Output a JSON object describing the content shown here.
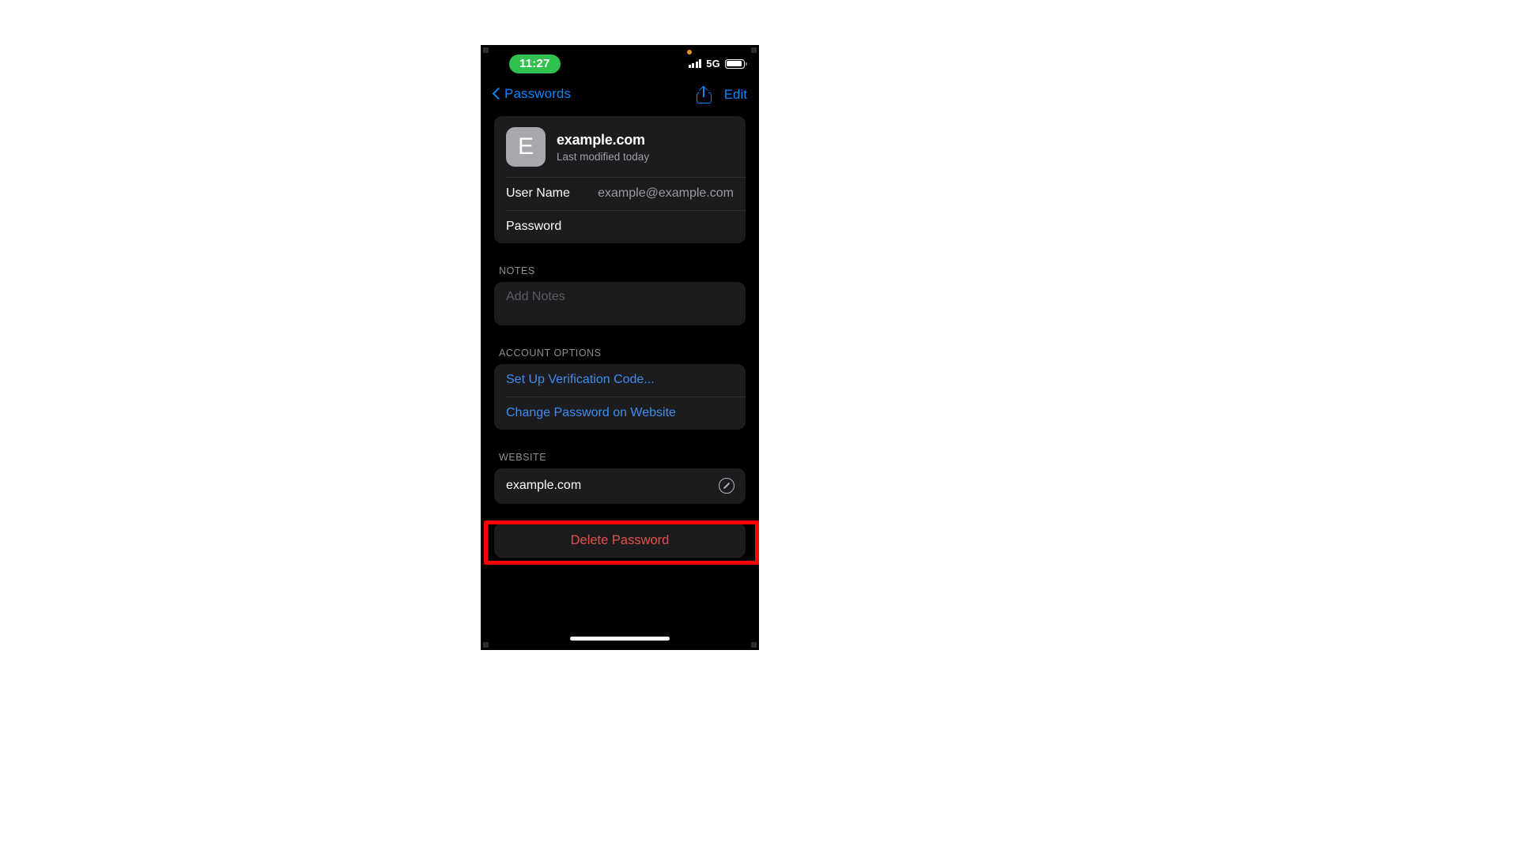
{
  "statusbar": {
    "time": "11:27",
    "network_label": "5G",
    "signal_icon": "cellular-signal-icon",
    "battery_icon": "battery-icon",
    "privacy_dot": "orange-microphone-indicator"
  },
  "navbar": {
    "back_label": "Passwords",
    "back_icon": "chevron-left-icon",
    "share_icon": "share-icon",
    "edit_label": "Edit"
  },
  "entry": {
    "icon_letter": "E",
    "title": "example.com",
    "subtitle": "Last modified today",
    "fields": [
      {
        "label": "User Name",
        "value": "example@example.com"
      },
      {
        "label": "Password",
        "value": ""
      }
    ]
  },
  "notes": {
    "section_header": "NOTES",
    "placeholder": "Add Notes",
    "value": ""
  },
  "account_options": {
    "section_header": "ACCOUNT OPTIONS",
    "items": [
      {
        "label": "Set Up Verification Code..."
      },
      {
        "label": "Change Password on Website"
      }
    ]
  },
  "website": {
    "section_header": "WEBSITE",
    "value": "example.com",
    "open_icon": "safari-compass-icon"
  },
  "delete": {
    "label": "Delete Password"
  },
  "colors": {
    "accent_blue": "#0a84ff",
    "link_blue": "#3d8ef0",
    "destructive_red": "#e0504a",
    "highlight_red": "#ff0000",
    "card_background": "#1c1c1e",
    "screen_background": "#000000",
    "time_pill_green": "#30c14e"
  }
}
